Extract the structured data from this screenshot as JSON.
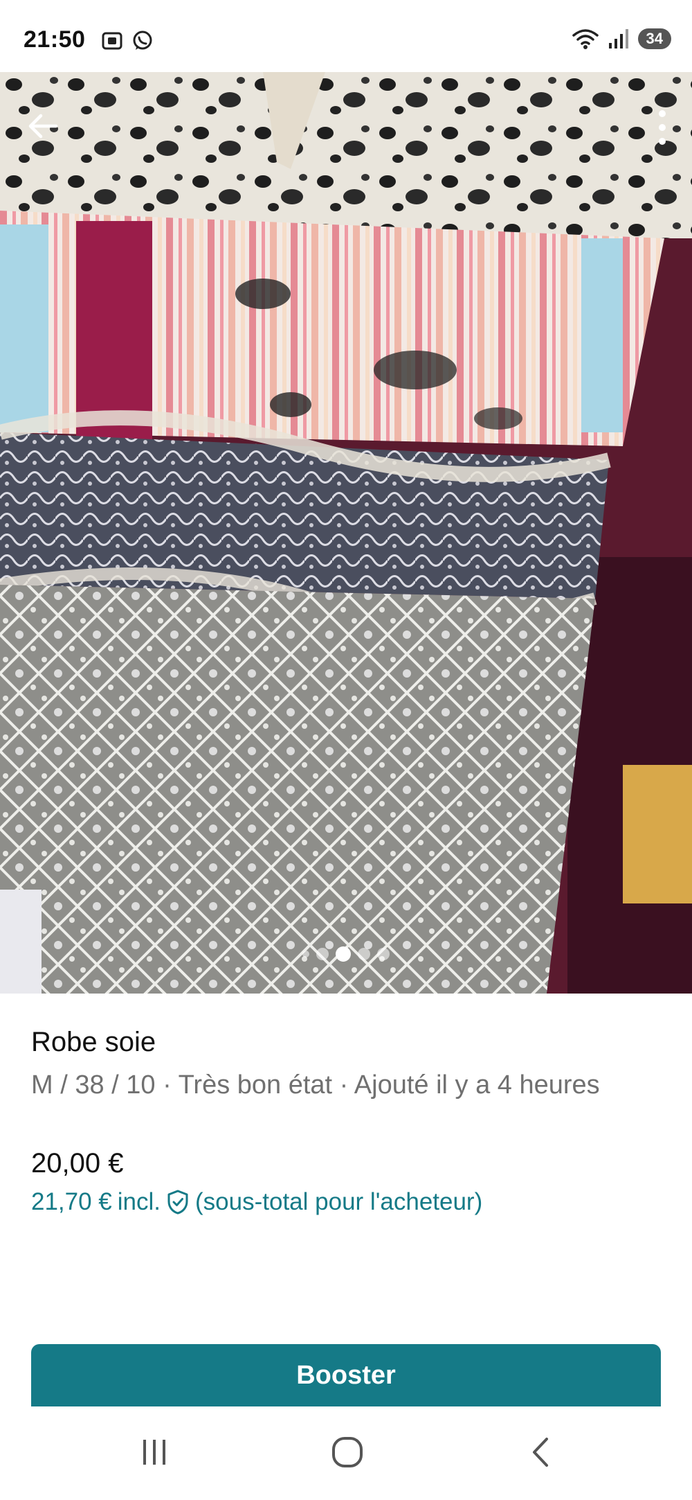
{
  "status_bar": {
    "time": "21:50",
    "battery": "34",
    "icons": [
      "screenshot-icon",
      "whatsapp-icon",
      "wifi-icon",
      "signal-icon"
    ]
  },
  "gallery": {
    "page_count": 5,
    "active_index": 2
  },
  "listing": {
    "title": "Robe soie",
    "meta": "M / 38 / 10 · Très bon état · Ajouté il y a 4 heures",
    "price": "20,00 €",
    "price_incl_amount": "21,70 €",
    "price_incl_word": "incl.",
    "price_incl_note": "(sous-total pour l'acheteur)"
  },
  "actions": {
    "booster_label": "Booster"
  },
  "colors": {
    "accent": "#157a87",
    "meta_text": "#707070"
  }
}
